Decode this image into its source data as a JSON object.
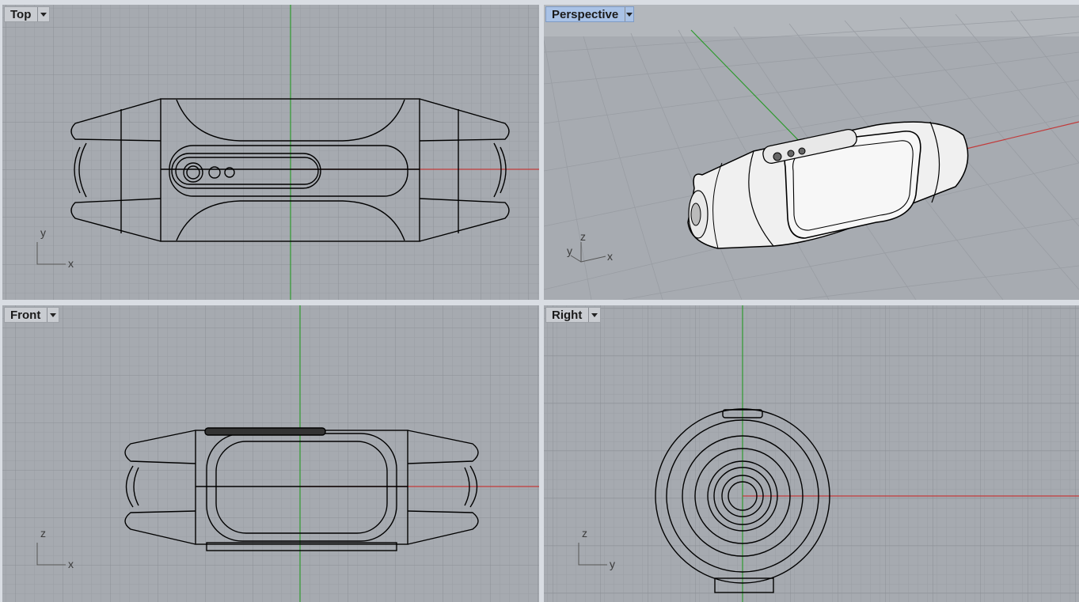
{
  "viewports": {
    "top": {
      "label": "Top",
      "axis_labels": [
        "y",
        "x"
      ]
    },
    "perspective": {
      "label": "Perspective",
      "axis_labels": [
        "z",
        "y",
        "x"
      ]
    },
    "front": {
      "label": "Front",
      "axis_labels": [
        "z",
        "x"
      ]
    },
    "right": {
      "label": "Right",
      "axis_labels": [
        "z",
        "y"
      ]
    }
  },
  "colors": {
    "viewport_bg": "#a6aab0",
    "grid_minor": "#9a9ea4",
    "grid_major": "#8a8e94",
    "x_axis": "#c23a3a",
    "y_axis": "#2f9a2f",
    "active_tab": "#a9c2e6",
    "model_wire": "#000000",
    "model_shaded": "#f2f2f2"
  },
  "icons": [
    "dropdown-arrow-icon"
  ]
}
